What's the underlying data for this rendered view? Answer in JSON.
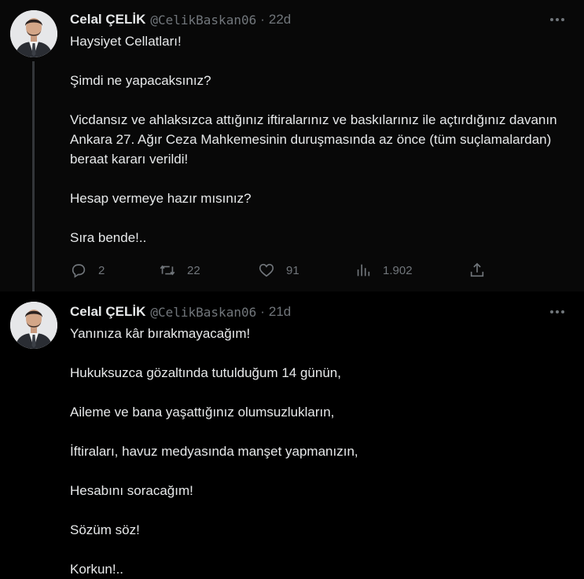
{
  "tweets": [
    {
      "author_name": "Celal ÇELİK",
      "handle": "@CelikBaskan06",
      "separator": "·",
      "time": "22d",
      "paragraphs": [
        "Haysiyet Cellatları!",
        "Şimdi ne yapacaksınız?",
        "Vicdansız ve ahlaksızca attığınız iftiralarınız ve baskılarınız ile açtırdığınız davanın Ankara 27. Ağır Ceza Mahkemesinin duruşmasında az önce (tüm suçlamalardan) beraat kararı verildi!",
        "Hesap vermeye hazır mısınız?",
        "Sıra bende!.."
      ],
      "stats": {
        "replies": "2",
        "retweets": "22",
        "likes": "91",
        "views": "1.902"
      }
    },
    {
      "author_name": "Celal ÇELİK",
      "handle": "@CelikBaskan06",
      "separator": "·",
      "time": "21d",
      "paragraphs": [
        "Yanınıza kâr bırakmayacağım!",
        "Hukuksuzca gözaltında tutulduğum 14 günün,",
        "Aileme ve bana yaşattığınız olumsuzlukların,",
        "İftiraları, havuz medyasında manşet yapmanızın,",
        "Hesabını soracağım!",
        "Sözüm söz!",
        "Korkun!.."
      ]
    }
  ],
  "icons": {
    "reply": "reply-icon",
    "retweet": "retweet-icon",
    "like": "heart-icon",
    "views": "views-chart-icon",
    "share": "share-icon",
    "more": "more-dots-icon"
  },
  "colors": {
    "background": "#000000",
    "text": "#e7e9ea",
    "muted": "#71767b",
    "thread_line": "#333639"
  }
}
